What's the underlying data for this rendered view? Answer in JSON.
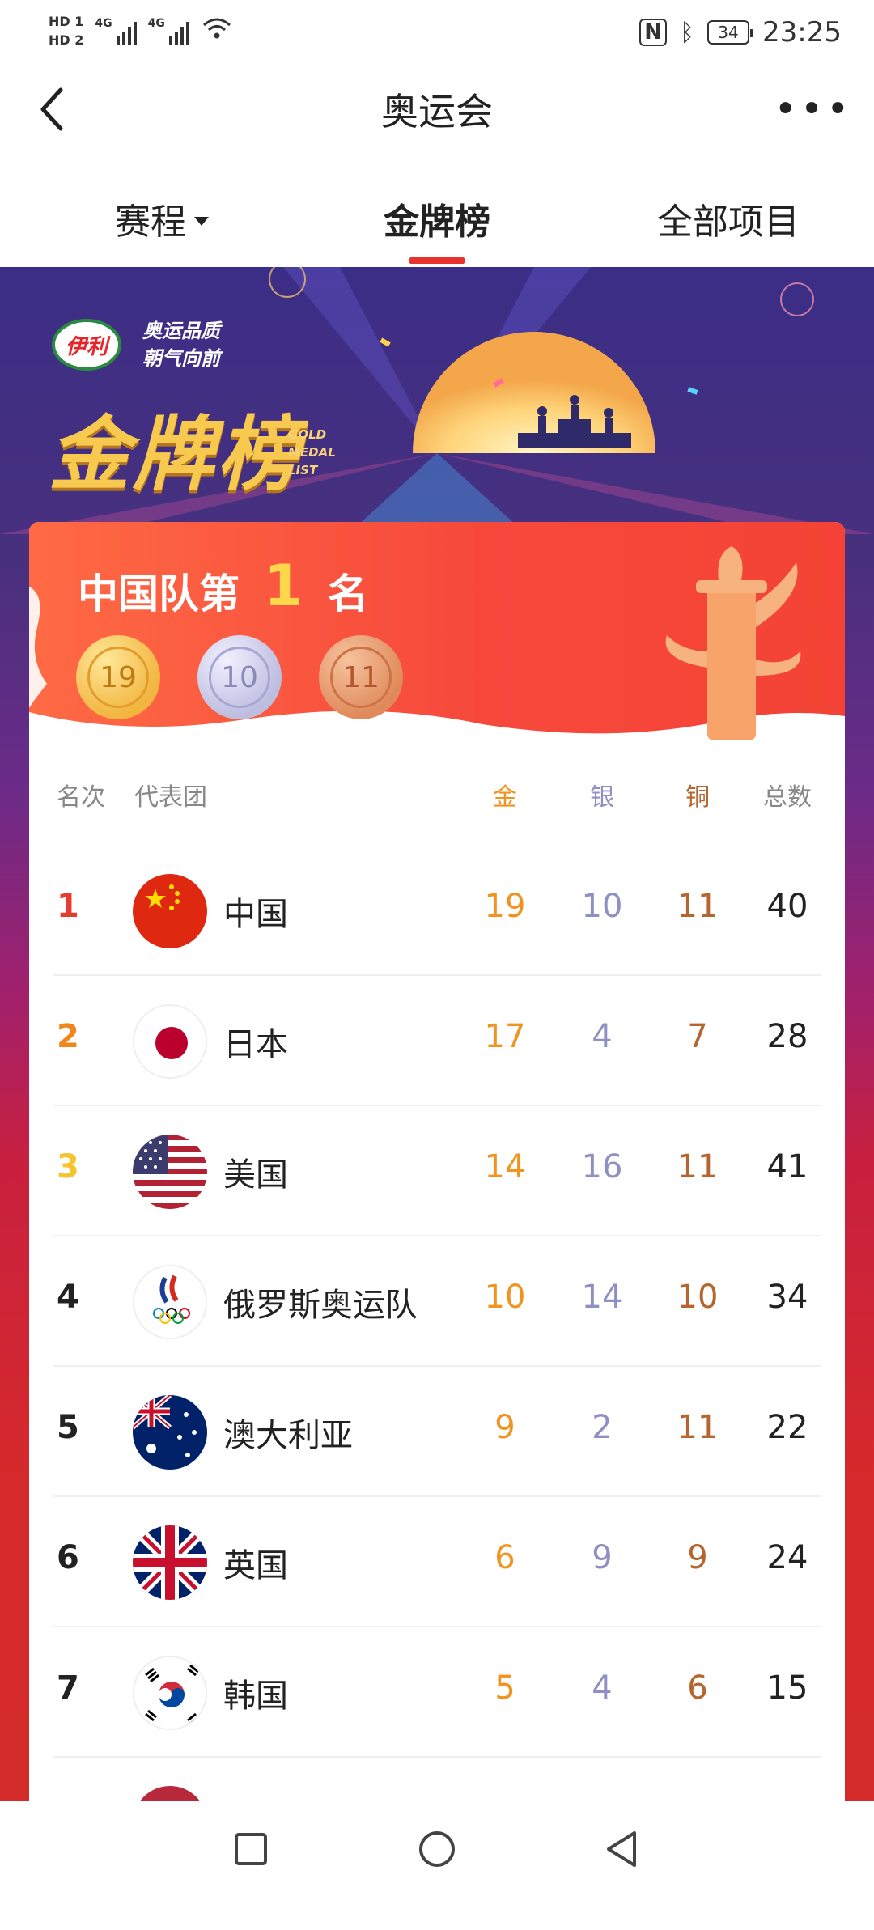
{
  "status_bar": {
    "hd1": "HD 1",
    "hd2": "HD 2",
    "net1": "4G",
    "net2": "4G",
    "battery": "34",
    "time": "23:25"
  },
  "nav": {
    "title": "奥运会",
    "more": "•••"
  },
  "tabs": {
    "schedule": "赛程",
    "medals": "金牌榜",
    "all_events": "全部项目",
    "active": "medals"
  },
  "banner": {
    "brand": "伊利",
    "slogan_line1": "奥运品质",
    "slogan_line2": "朝气向前",
    "title": "金牌榜",
    "sub1": "GOLD",
    "sub2": "MEDAL",
    "sub3": "LIST"
  },
  "summary": {
    "prefix": "中国队第",
    "rank": "1",
    "suffix": "名",
    "gold": "19",
    "silver": "10",
    "bronze": "11"
  },
  "table": {
    "headers": {
      "rank": "名次",
      "team": "代表团",
      "gold": "金",
      "silver": "银",
      "bronze": "铜",
      "total": "总数"
    },
    "rows": [
      {
        "rank": "1",
        "team": "中国",
        "gold": "19",
        "silver": "10",
        "bronze": "11",
        "total": "40",
        "flag": "china-flag-icon"
      },
      {
        "rank": "2",
        "team": "日本",
        "gold": "17",
        "silver": "4",
        "bronze": "7",
        "total": "28",
        "flag": "japan-flag-icon"
      },
      {
        "rank": "3",
        "team": "美国",
        "gold": "14",
        "silver": "16",
        "bronze": "11",
        "total": "41",
        "flag": "usa-flag-icon"
      },
      {
        "rank": "4",
        "team": "俄罗斯奥运队",
        "gold": "10",
        "silver": "14",
        "bronze": "10",
        "total": "34",
        "flag": "roc-flag-icon"
      },
      {
        "rank": "5",
        "team": "澳大利亚",
        "gold": "9",
        "silver": "2",
        "bronze": "11",
        "total": "22",
        "flag": "australia-flag-icon"
      },
      {
        "rank": "6",
        "team": "英国",
        "gold": "6",
        "silver": "9",
        "bronze": "9",
        "total": "24",
        "flag": "uk-flag-icon"
      },
      {
        "rank": "7",
        "team": "韩国",
        "gold": "5",
        "silver": "4",
        "bronze": "6",
        "total": "15",
        "flag": "korea-flag-icon"
      }
    ]
  },
  "colors": {
    "accent": "#e8322e",
    "gold": "#f0931f",
    "silver": "#8e8fc2",
    "bronze": "#b5652f"
  }
}
